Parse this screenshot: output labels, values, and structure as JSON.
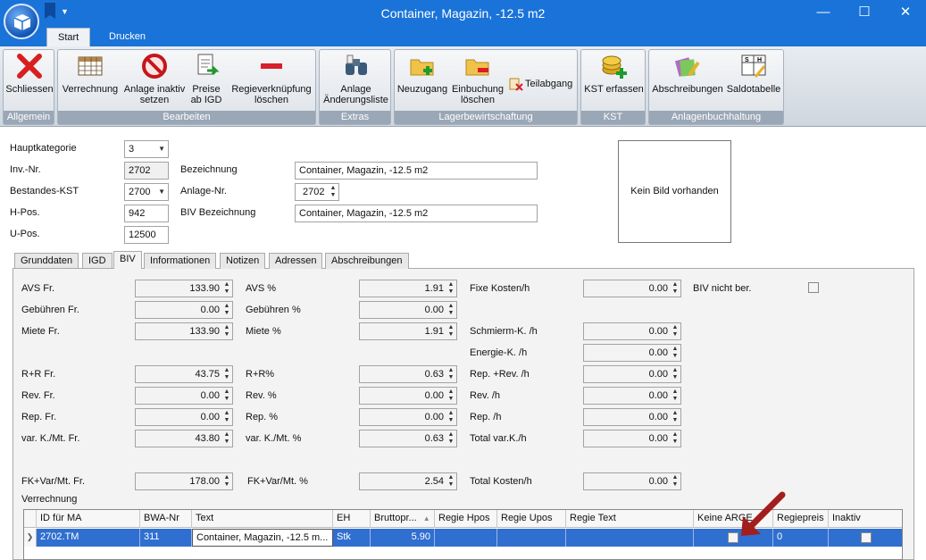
{
  "window": {
    "title": "Container, Magazin, -12.5 m2",
    "minimize": "—",
    "maximize": "☐",
    "close": "✕"
  },
  "ribbon_tabs": [
    {
      "label": "Start"
    },
    {
      "label": "Drucken"
    }
  ],
  "ribbon": {
    "groups": {
      "allgemein": "Allgemein",
      "bearbeiten": "Bearbeiten",
      "extras": "Extras",
      "lager": "Lagerbewirtschaftung",
      "kst": "KST",
      "anlagen": "Anlagenbuchhaltung"
    },
    "buttons": {
      "schliessen": "Schliessen",
      "verrechnung": "Verrechnung",
      "anlage_inaktiv_1": "Anlage inaktiv",
      "anlage_inaktiv_2": "setzen",
      "preise_1": "Preise",
      "preise_2": "ab IGD",
      "regie_1": "Regieverknüpfung",
      "regie_2": "löschen",
      "aend_1": "Anlage",
      "aend_2": "Änderungsliste",
      "neuzugang": "Neuzugang",
      "einbuchung_1": "Einbuchung",
      "einbuchung_2": "löschen",
      "teilabgang": "Teilabgang",
      "kst_erfassen": "KST erfassen",
      "abschreibungen": "Abschreibungen",
      "saldotabelle": "Saldotabelle"
    }
  },
  "header": {
    "hauptkategorie_label": "Hauptkategorie",
    "hauptkategorie_value": "3",
    "inv_nr_label": "Inv.-Nr.",
    "inv_nr_value": "2702",
    "bestandes_kst_label": "Bestandes-KST",
    "bestandes_kst_value": "2700",
    "h_pos_label": "H-Pos.",
    "h_pos_value": "942",
    "u_pos_label": "U-Pos.",
    "u_pos_value": "12500",
    "bezeichnung_label": "Bezeichnung",
    "bezeichnung_value": "Container, Magazin, -12.5 m2",
    "anlage_nr_label": "Anlage-Nr.",
    "anlage_nr_value": "2702",
    "biv_bez_label": "BIV Bezeichnung",
    "biv_bez_value": "Container, Magazin, -12.5 m2",
    "kein_bild": "Kein Bild vorhanden"
  },
  "tabs": [
    {
      "label": "Grunddaten"
    },
    {
      "label": "IGD"
    },
    {
      "label": "BIV"
    },
    {
      "label": "Informationen"
    },
    {
      "label": "Notizen"
    },
    {
      "label": "Adressen"
    },
    {
      "label": "Abschreibungen"
    }
  ],
  "biv": {
    "col1": [
      {
        "label": "AVS Fr.",
        "value": "133.90"
      },
      {
        "label": "Gebühren Fr.",
        "value": "0.00"
      },
      {
        "label": "Miete Fr.",
        "value": "133.90"
      },
      {
        "label": "R+R Fr.",
        "value": "43.75"
      },
      {
        "label": "Rev. Fr.",
        "value": "0.00"
      },
      {
        "label": "Rep. Fr.",
        "value": "0.00"
      },
      {
        "label": "var. K./Mt. Fr.",
        "value": "43.80"
      },
      {
        "label": "FK+Var/Mt. Fr.",
        "value": "178.00"
      }
    ],
    "col2": [
      {
        "label": "AVS %",
        "value": "1.91"
      },
      {
        "label": "Gebühren %",
        "value": "0.00"
      },
      {
        "label": "Miete %",
        "value": "1.91"
      },
      {
        "label": "R+R%",
        "value": "0.63"
      },
      {
        "label": "Rev. %",
        "value": "0.00"
      },
      {
        "label": "Rep. %",
        "value": "0.00"
      },
      {
        "label": "var. K./Mt. %",
        "value": "0.63"
      },
      {
        "label": "FK+Var/Mt. %",
        "value": "2.54"
      }
    ],
    "col3": [
      {
        "label": "Fixe Kosten/h",
        "value": "0.00"
      },
      {
        "label": "Schmierm-K. /h",
        "value": "0.00"
      },
      {
        "label": "Energie-K. /h",
        "value": "0.00"
      },
      {
        "label": "Rep. +Rev. /h",
        "value": "0.00"
      },
      {
        "label": "Rev. /h",
        "value": "0.00"
      },
      {
        "label": "Rep. /h",
        "value": "0.00"
      },
      {
        "label": "Total var.K./h",
        "value": "0.00"
      },
      {
        "label": "Total Kosten/h",
        "value": "0.00"
      }
    ],
    "biv_nicht_ber_label": "BIV nicht ber.",
    "verrechnung_label": "Verrechnung"
  },
  "grid": {
    "columns": [
      {
        "label": "ID für MA"
      },
      {
        "label": "BWA-Nr"
      },
      {
        "label": "Text"
      },
      {
        "label": "EH"
      },
      {
        "label": "Bruttopr..."
      },
      {
        "label": "Regie Hpos"
      },
      {
        "label": "Regie Upos"
      },
      {
        "label": "Regie Text"
      },
      {
        "label": "Keine ARGE"
      },
      {
        "label": "Regiepreis"
      },
      {
        "label": "Inaktiv"
      }
    ],
    "sort_glyph": "▲",
    "row": {
      "indicator": "❯",
      "id": "2702.TM",
      "bwa": "311",
      "text": "Container, Magazin, -12.5 m...",
      "eh": "Stk",
      "brutto": "5.90",
      "regie_hpos": "",
      "regie_upos": "",
      "regie_text": "",
      "regiepreis": "0"
    }
  },
  "colors": {
    "titlebar": "#1a73d8",
    "selected_row": "#2f6fd0",
    "annotation_arrow": "#a31d1d"
  }
}
